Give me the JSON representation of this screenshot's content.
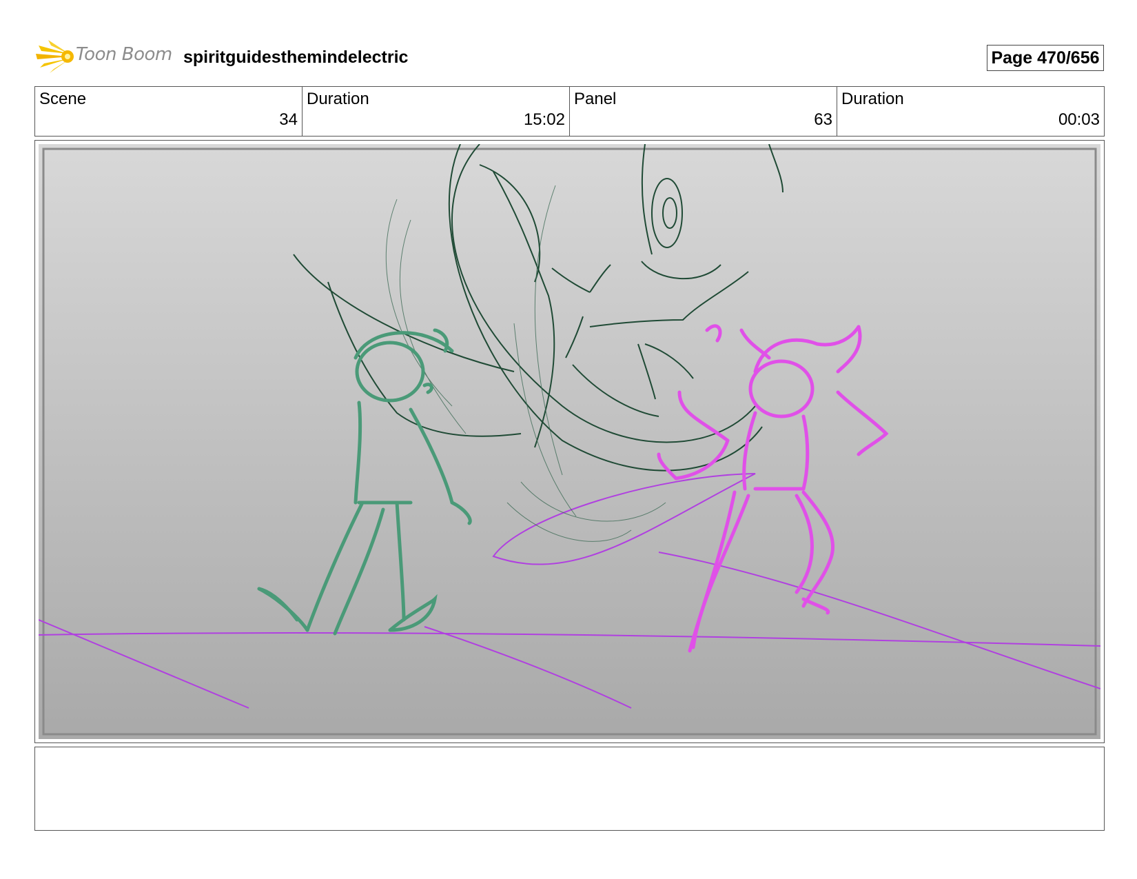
{
  "header": {
    "logo_text": "Toon Boom",
    "project_title": "spiritguidesthemindelectric",
    "page_label": "Page 470/656"
  },
  "info": {
    "scene_label": "Scene",
    "scene_value": "34",
    "scene_duration_label": "Duration",
    "scene_duration_value": "15:02",
    "panel_label": "Panel",
    "panel_value": "63",
    "panel_duration_label": "Duration",
    "panel_duration_value": "00:03"
  },
  "notes": {
    "text": ""
  },
  "colors": {
    "sketch_dark_green": "#1f4a35",
    "sketch_teal": "#4a9a78",
    "sketch_magenta": "#e050e8",
    "ground_purple": "#b040e0"
  }
}
